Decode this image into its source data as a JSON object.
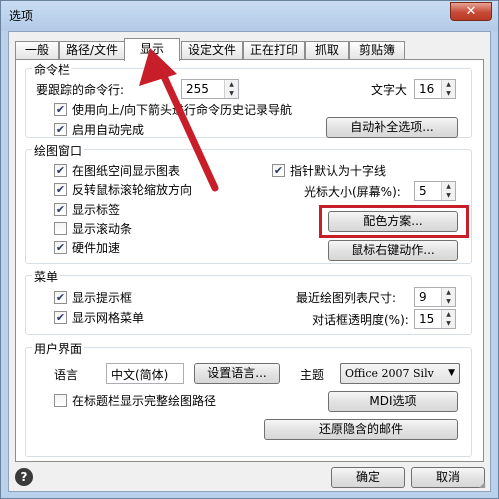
{
  "window": {
    "title": "选项",
    "close_glyph": "✕"
  },
  "tabs": [
    {
      "label": "一般"
    },
    {
      "label": "路径/文件"
    },
    {
      "label": "显示"
    },
    {
      "label": "设定文件"
    },
    {
      "label": "正在打印"
    },
    {
      "label": "抓取"
    },
    {
      "label": "剪贴簿"
    }
  ],
  "command_bar": {
    "title": "命令栏",
    "history_label": "要跟踪的命令行:",
    "history_value": "255",
    "font_size_label": "文字大",
    "font_size_value": "16",
    "arrow_nav_label": "使用向上/向下箭头进行命令历史记录导航",
    "autocomplete_label": "启用自动完成",
    "autocomplete_options_button": "自动补全选项..."
  },
  "drawing_window": {
    "title": "绘图窗口",
    "show_icon_label": "在图纸空间显示图表",
    "reverse_wheel_label": "反转鼠标滚轮缩放方向",
    "show_tabs_label": "显示标签",
    "show_scrollbars_label": "显示滚动条",
    "hw_accel_label": "硬件加速",
    "crosshair_label": "指针默认为十字线",
    "cursor_size_label": "光标大小(屏幕%):",
    "cursor_size_value": "5",
    "color_scheme_button": "配色方案...",
    "right_click_button": "鼠标右键动作..."
  },
  "menu": {
    "title": "菜单",
    "show_tips_label": "显示提示框",
    "grid_menu_label": "显示网格菜单",
    "recent_list_label": "最近绘图列表尺寸:",
    "recent_list_value": "9",
    "dialog_opacity_label": "对话框透明度(%):",
    "dialog_opacity_value": "15"
  },
  "ui": {
    "title": "用户界面",
    "language_label": "语言",
    "language_value": "中文(简体)",
    "set_language_button": "设置语言...",
    "theme_label": "主题",
    "theme_value": "Office 2007 Silv",
    "title_path_label": "在标题栏显示完整绘图路径",
    "mdi_button": "MDI选项",
    "restore_mail_button": "还原隐含的邮件"
  },
  "footer": {
    "ok_button": "确定",
    "cancel_button": "取消",
    "help_glyph": "?"
  },
  "colors": {
    "highlight": "#c81e2a",
    "arrow": "#c81e2a",
    "title_bar": "#b9d1ea"
  }
}
